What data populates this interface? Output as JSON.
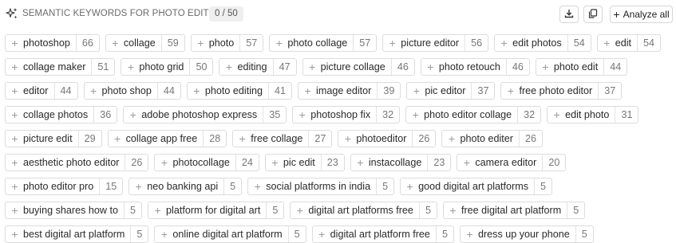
{
  "header": {
    "title": "SEMANTIC KEYWORDS FOR PHOTO EDITOR",
    "count": "0 / 50",
    "analyze_label": "Analyze all",
    "icons": [
      "sparkle-icon",
      "download-icon",
      "copy-icon",
      "plus-icon"
    ]
  },
  "keywords": [
    {
      "term": "photoshop",
      "volume": "66"
    },
    {
      "term": "collage",
      "volume": "59"
    },
    {
      "term": "photo",
      "volume": "57"
    },
    {
      "term": "photo collage",
      "volume": "57"
    },
    {
      "term": "picture editor",
      "volume": "56"
    },
    {
      "term": "edit photos",
      "volume": "54"
    },
    {
      "term": "edit",
      "volume": "54"
    },
    {
      "term": "collage maker",
      "volume": "51"
    },
    {
      "term": "photo grid",
      "volume": "50"
    },
    {
      "term": "editing",
      "volume": "47"
    },
    {
      "term": "picture collage",
      "volume": "46"
    },
    {
      "term": "photo retouch",
      "volume": "46"
    },
    {
      "term": "photo edit",
      "volume": "44"
    },
    {
      "term": "editor",
      "volume": "44"
    },
    {
      "term": "photo shop",
      "volume": "44"
    },
    {
      "term": "photo editing",
      "volume": "41"
    },
    {
      "term": "image editor",
      "volume": "39"
    },
    {
      "term": "pic editor",
      "volume": "37"
    },
    {
      "term": "free photo editor",
      "volume": "37"
    },
    {
      "term": "collage photos",
      "volume": "36"
    },
    {
      "term": "adobe photoshop express",
      "volume": "35"
    },
    {
      "term": "photoshop fix",
      "volume": "32"
    },
    {
      "term": "photo editor collage",
      "volume": "32"
    },
    {
      "term": "edit photo",
      "volume": "31"
    },
    {
      "term": "picture edit",
      "volume": "29"
    },
    {
      "term": "collage app free",
      "volume": "28"
    },
    {
      "term": "free collage",
      "volume": "27"
    },
    {
      "term": "photoeditor",
      "volume": "26"
    },
    {
      "term": "photo editer",
      "volume": "26"
    },
    {
      "term": "aesthetic photo editor",
      "volume": "26"
    },
    {
      "term": "photocollage",
      "volume": "24"
    },
    {
      "term": "pic edit",
      "volume": "23"
    },
    {
      "term": "instacollage",
      "volume": "23"
    },
    {
      "term": "camera editor",
      "volume": "20"
    },
    {
      "term": "photo editor pro",
      "volume": "15"
    },
    {
      "term": "neo banking api",
      "volume": "5"
    },
    {
      "term": "social platforms in india",
      "volume": "5"
    },
    {
      "term": "good digital art platforms",
      "volume": "5"
    },
    {
      "term": "buying shares how to",
      "volume": "5"
    },
    {
      "term": "platform for digital art",
      "volume": "5"
    },
    {
      "term": "digital art platforms free",
      "volume": "5"
    },
    {
      "term": "free digital art platform",
      "volume": "5"
    },
    {
      "term": "best digital art platform",
      "volume": "5"
    },
    {
      "term": "online digital art platform",
      "volume": "5"
    },
    {
      "term": "digital art platform free",
      "volume": "5"
    },
    {
      "term": "dress up your phone",
      "volume": "5"
    }
  ]
}
